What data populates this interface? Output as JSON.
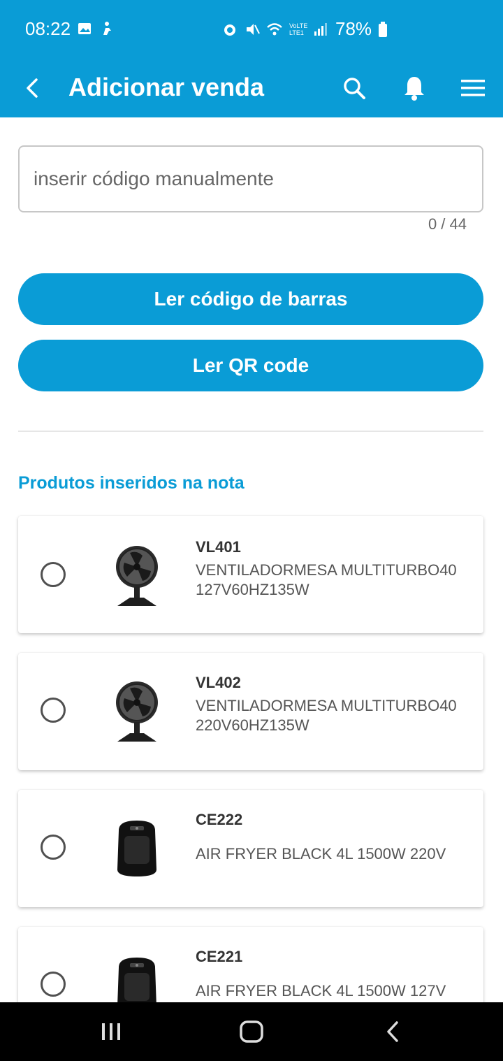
{
  "status_bar": {
    "time": "08:22",
    "battery": "78%",
    "network": "VoLTE LTE1"
  },
  "app_bar": {
    "title": "Adicionar venda"
  },
  "code_input": {
    "placeholder": "inserir código manualmente",
    "value": "",
    "counter": "0 / 44"
  },
  "buttons": {
    "barcode_label": "Ler código de barras",
    "qr_label": "Ler QR code"
  },
  "section": {
    "title": "Produtos inseridos na nota"
  },
  "products": [
    {
      "code": "VL401",
      "line1": "VENTILADORMESA MULTITURBO40",
      "line2": "127V60HZ135W",
      "thumb": "fan-icon"
    },
    {
      "code": "VL402",
      "line1": "VENTILADORMESA MULTITURBO40",
      "line2": "220V60HZ135W",
      "thumb": "fan-icon"
    },
    {
      "code": "CE222",
      "line1": "AIR FRYER BLACK 4L 1500W 220V",
      "line2": "",
      "thumb": "air-fryer-icon"
    },
    {
      "code": "CE221",
      "line1": "AIR FRYER BLACK 4L 1500W 127V",
      "line2": "",
      "thumb": "air-fryer-icon"
    }
  ],
  "colors": {
    "primary": "#0a9cd6",
    "nav_bar": "#000000",
    "text": "#555555"
  }
}
